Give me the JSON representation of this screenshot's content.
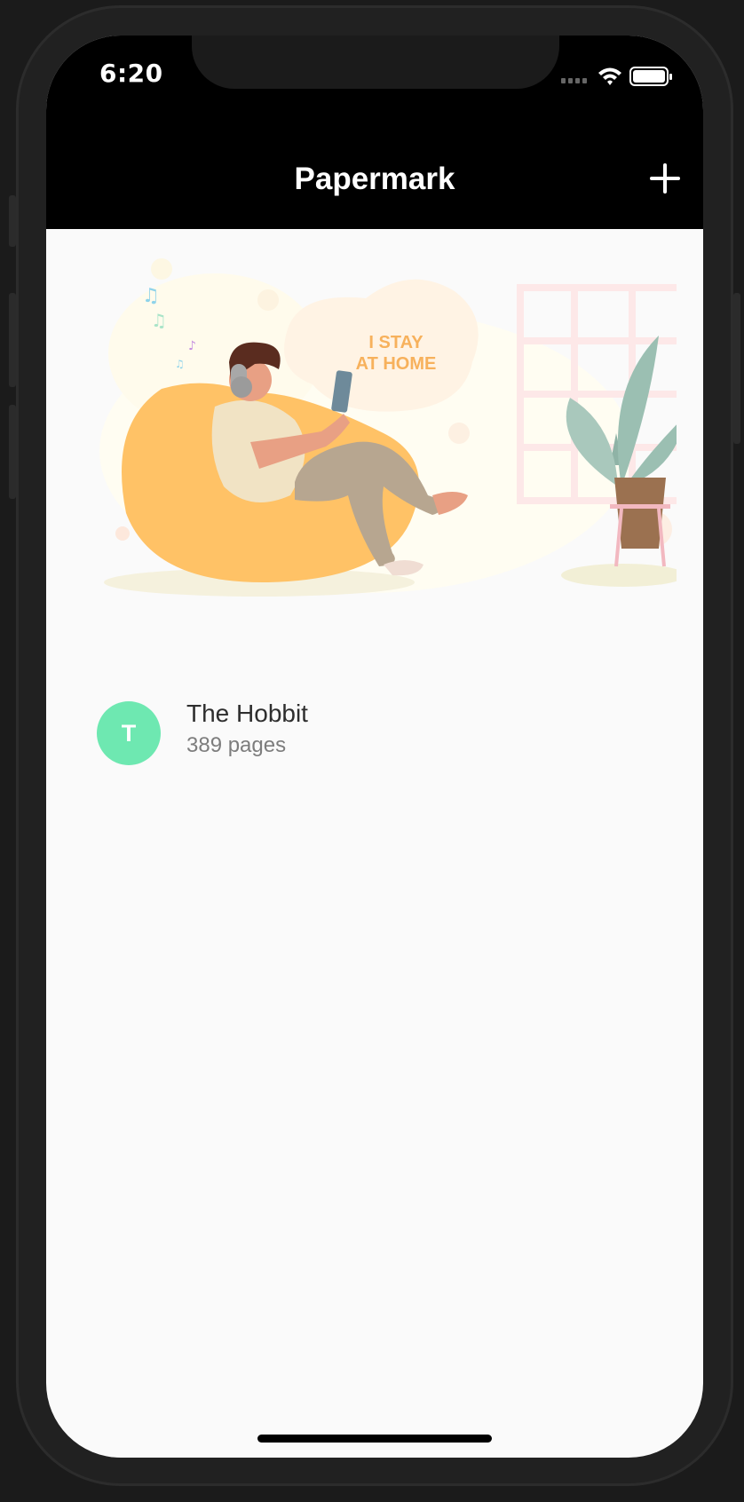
{
  "status_bar": {
    "time": "6:20",
    "icons": [
      "signal-icon",
      "wifi-icon",
      "battery-icon"
    ]
  },
  "nav": {
    "title": "Papermark",
    "add_icon": "plus-icon"
  },
  "hero": {
    "text_line_1": "I STAY",
    "text_line_2": "AT HOME"
  },
  "books": [
    {
      "initial": "T",
      "title": "The Hobbit",
      "subtitle": "389 pages"
    }
  ],
  "colors": {
    "nav_background": "#000000",
    "avatar": "#6ee8b1",
    "page_background": "#fafafa"
  }
}
